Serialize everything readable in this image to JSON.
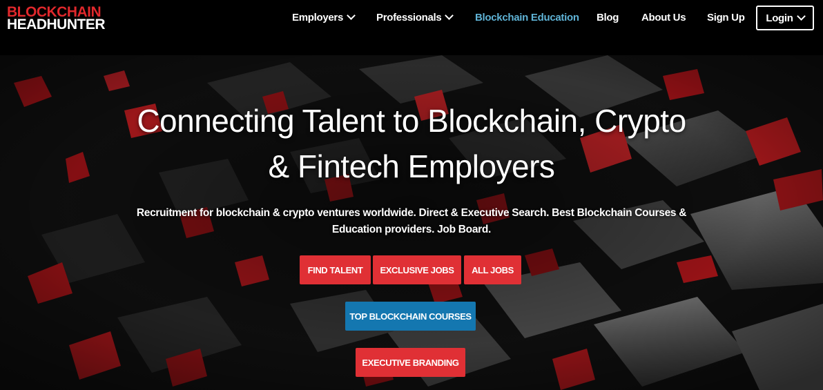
{
  "logo": {
    "line1": "BLOCKCHAIN",
    "line2": "HEADHUNTER"
  },
  "nav": {
    "employers": "Employers",
    "professionals": "Professionals",
    "education": "Blockchain Education",
    "blog": "Blog",
    "about": "About Us",
    "signup": "Sign Up",
    "login": "Login"
  },
  "hero": {
    "headline_line1": "Connecting Talent to Blockchain, Crypto",
    "headline_line2": "& Fintech Employers",
    "subtitle": "Recruitment for blockchain & crypto ventures worldwide. Direct & Executive Search. Best Blockchain Courses & Education providers. Job Board."
  },
  "buttons": {
    "find_talent": "FIND TALENT",
    "exclusive_jobs": "EXCLUSIVE JOBS",
    "all_jobs": "ALL JOBS",
    "top_courses": "TOP BLOCKCHAIN COURSES",
    "executive_branding": "EXECUTIVE BRANDING"
  },
  "colors": {
    "brand_red": "#e0282c",
    "button_red": "#e03035",
    "button_blue": "#1477b0",
    "active_link": "#5fb3d6",
    "background": "#000000"
  },
  "icons": {
    "dropdown": "chevron-down-icon"
  }
}
